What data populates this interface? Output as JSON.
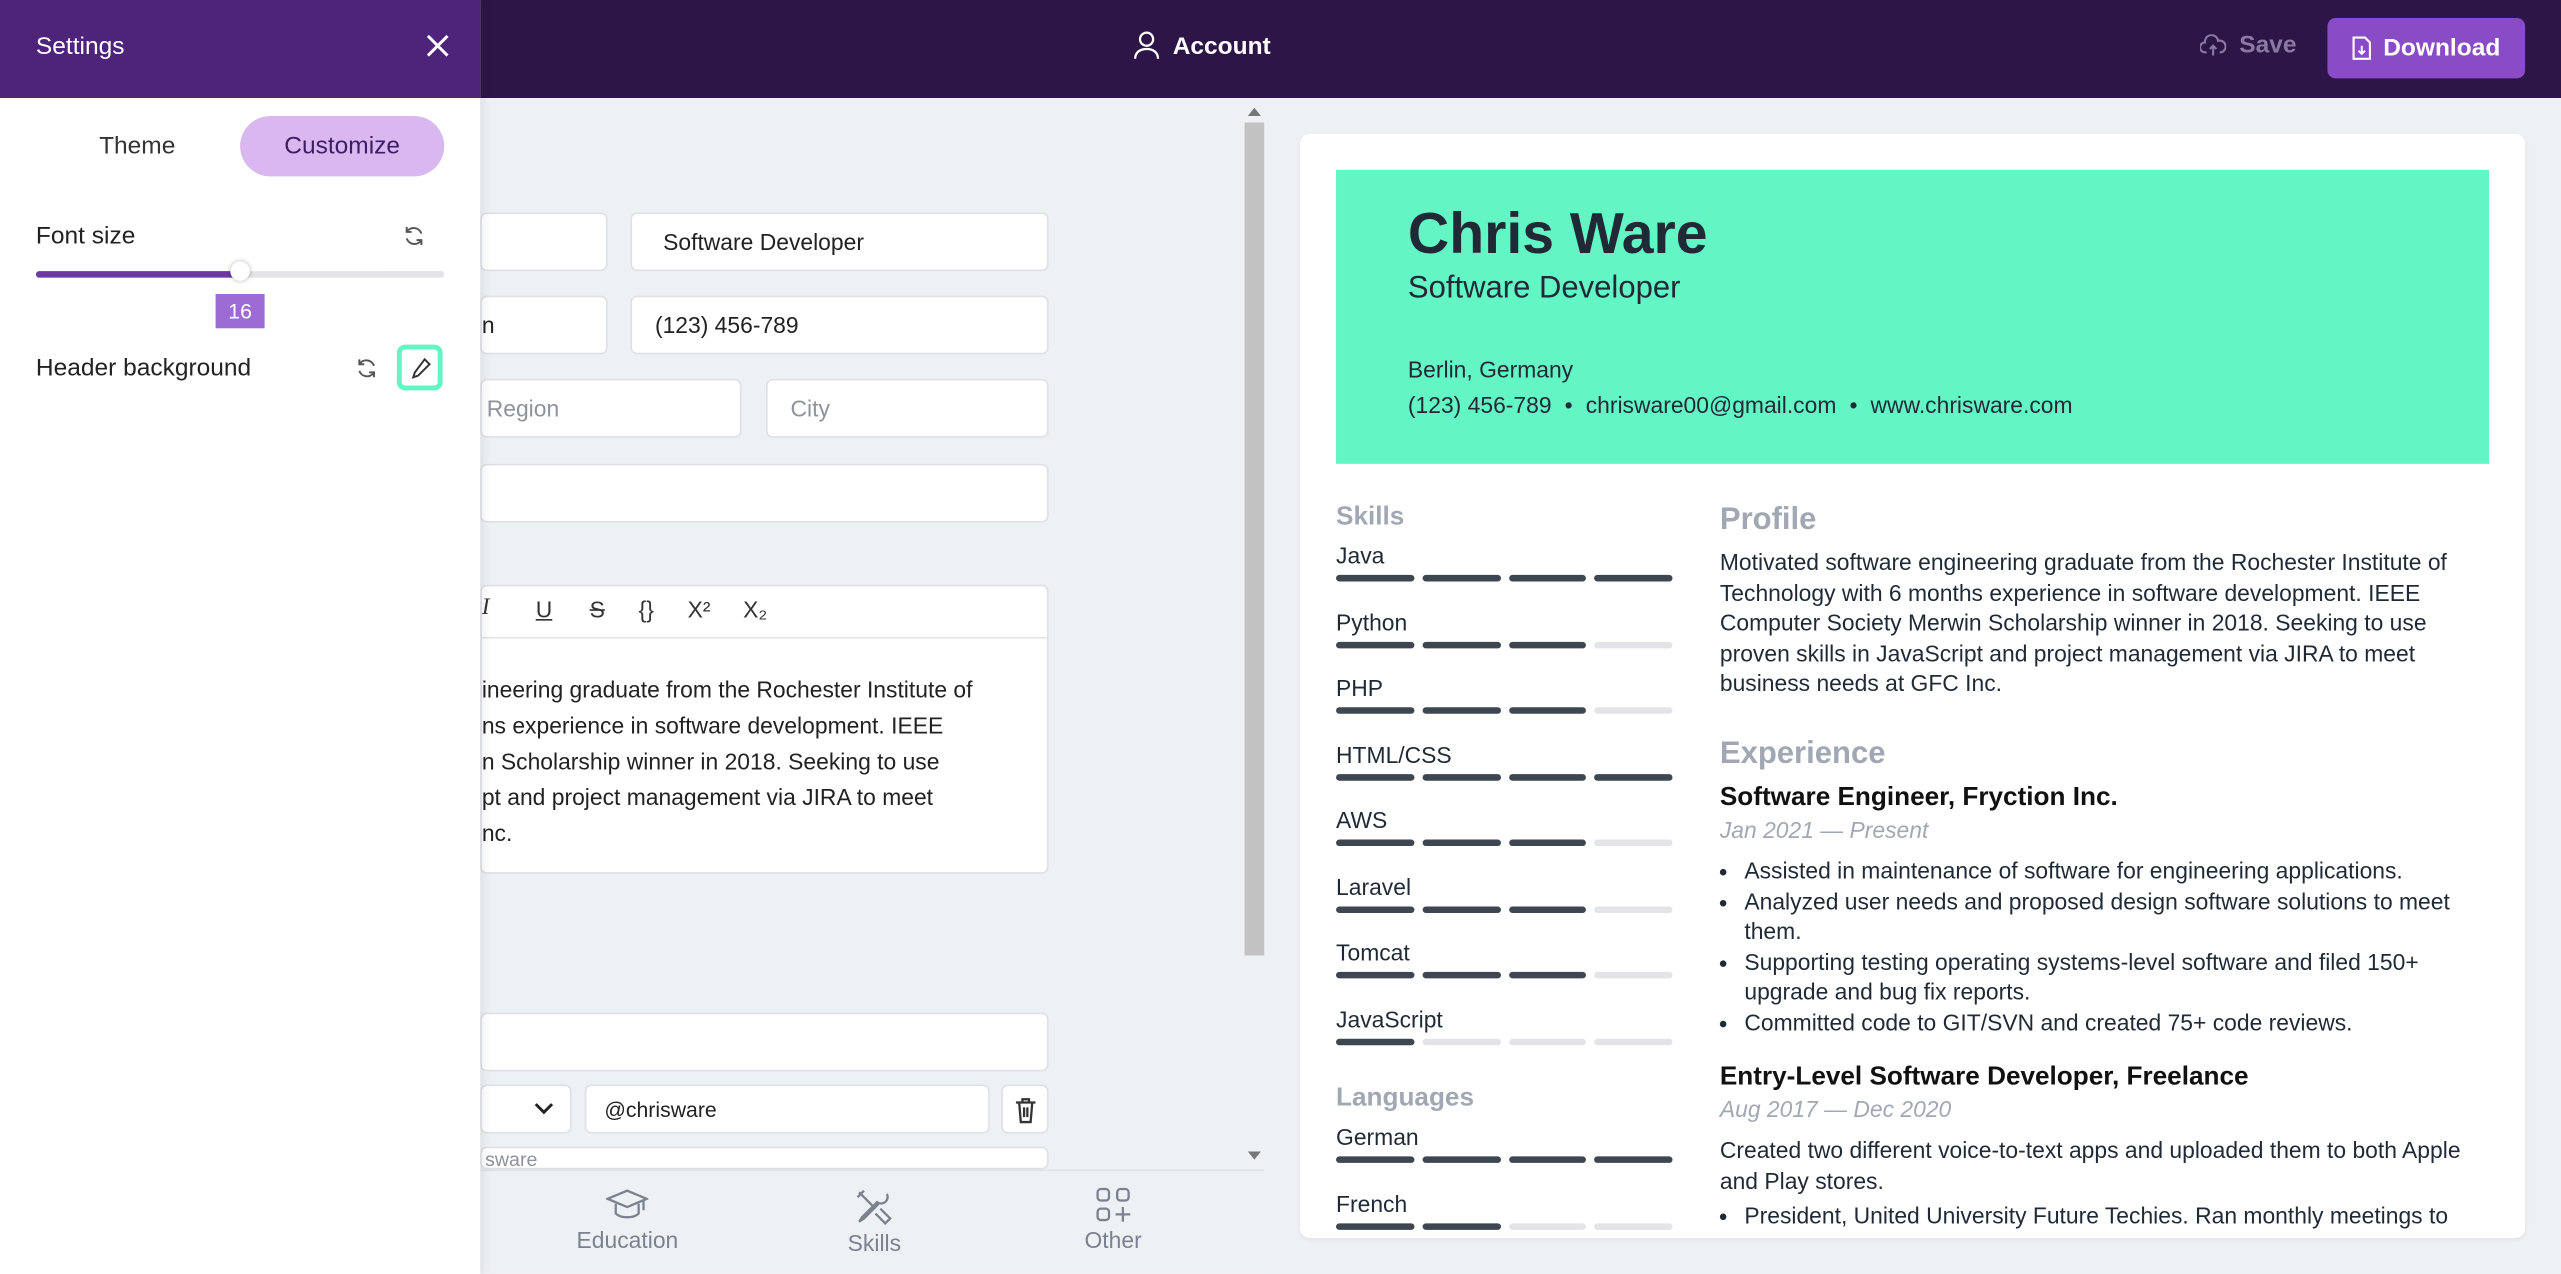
{
  "topbar": {
    "account_label": "Account",
    "save_label": "Save",
    "download_label": "Download"
  },
  "settings": {
    "title": "Settings",
    "tabs": [
      {
        "label": "Theme",
        "active": false
      },
      {
        "label": "Customize",
        "active": true
      }
    ],
    "font_size": {
      "label": "Font size",
      "value": "16",
      "fraction": 0.5
    },
    "header_background": {
      "label": "Header background",
      "color": "#64f5c5"
    }
  },
  "form": {
    "job_title": "Software Developer",
    "name_partial": "n",
    "phone": "(123) 456-789",
    "region_placeholder": "Region",
    "city_placeholder": "City",
    "toolbar": [
      "I",
      "U",
      "S",
      "{}",
      "X²",
      "X₂"
    ],
    "editor_lines": [
      "ineering graduate from the Rochester Institute of",
      "ns experience in software development. IEEE",
      "n Scholarship winner in 2018. Seeking to use",
      "pt and project management via JIRA to meet",
      "nc."
    ],
    "social_handle": "@chrisware",
    "social_partial": "sware"
  },
  "bottom_nav": [
    {
      "label": "Education",
      "icon": "graduation-cap-icon"
    },
    {
      "label": "Skills",
      "icon": "tools-icon"
    },
    {
      "label": "Other",
      "icon": "grid-plus-icon"
    }
  ],
  "resume": {
    "name": "Chris Ware",
    "job": "Software Developer",
    "location": "Berlin, Germany",
    "phone": "(123) 456-789",
    "email": "chrisware00@gmail.com",
    "website": "www.chrisware.com",
    "separator": "•",
    "skills_heading": "Skills",
    "skills": [
      {
        "name": "Java",
        "level": 4
      },
      {
        "name": "Python",
        "level": 3
      },
      {
        "name": "PHP",
        "level": 3
      },
      {
        "name": "HTML/CSS",
        "level": 4
      },
      {
        "name": "AWS",
        "level": 3
      },
      {
        "name": "Laravel",
        "level": 3
      },
      {
        "name": "Tomcat",
        "level": 3
      },
      {
        "name": "JavaScript",
        "level": 1
      }
    ],
    "languages_heading": "Languages",
    "languages": [
      {
        "name": "German",
        "level": 4
      },
      {
        "name": "French",
        "level": 2
      }
    ],
    "profile_heading": "Profile",
    "profile_text": "Motivated software engineering graduate from the Rochester Institute of Technology with 6 months experience in software development. IEEE Computer Society Merwin Scholarship winner in 2018. Seeking to use proven skills in JavaScript and project management via JIRA to meet business needs at GFC Inc.",
    "experience_heading": "Experience",
    "job1": {
      "title": "Software Engineer, Fryction Inc.",
      "dates": "Jan 2021 — Present",
      "bullets": [
        "Assisted in maintenance of software for engineering applications.",
        "Analyzed user needs and proposed design software solutions to meet them.",
        "Supporting testing operating systems-level software and filed 150+ upgrade and bug fix reports.",
        "Committed code to GIT/SVN and created 75+ code reviews."
      ]
    },
    "job2": {
      "title": "Entry-Level Software Developer, Freelance",
      "dates": "Aug 2017 — Dec 2020",
      "desc": "Created two different voice-to-text apps and uploaded them to both Apple and Play stores.",
      "bullets": [
        "President, United University Future Techies. Ran monthly meetings to"
      ]
    }
  }
}
